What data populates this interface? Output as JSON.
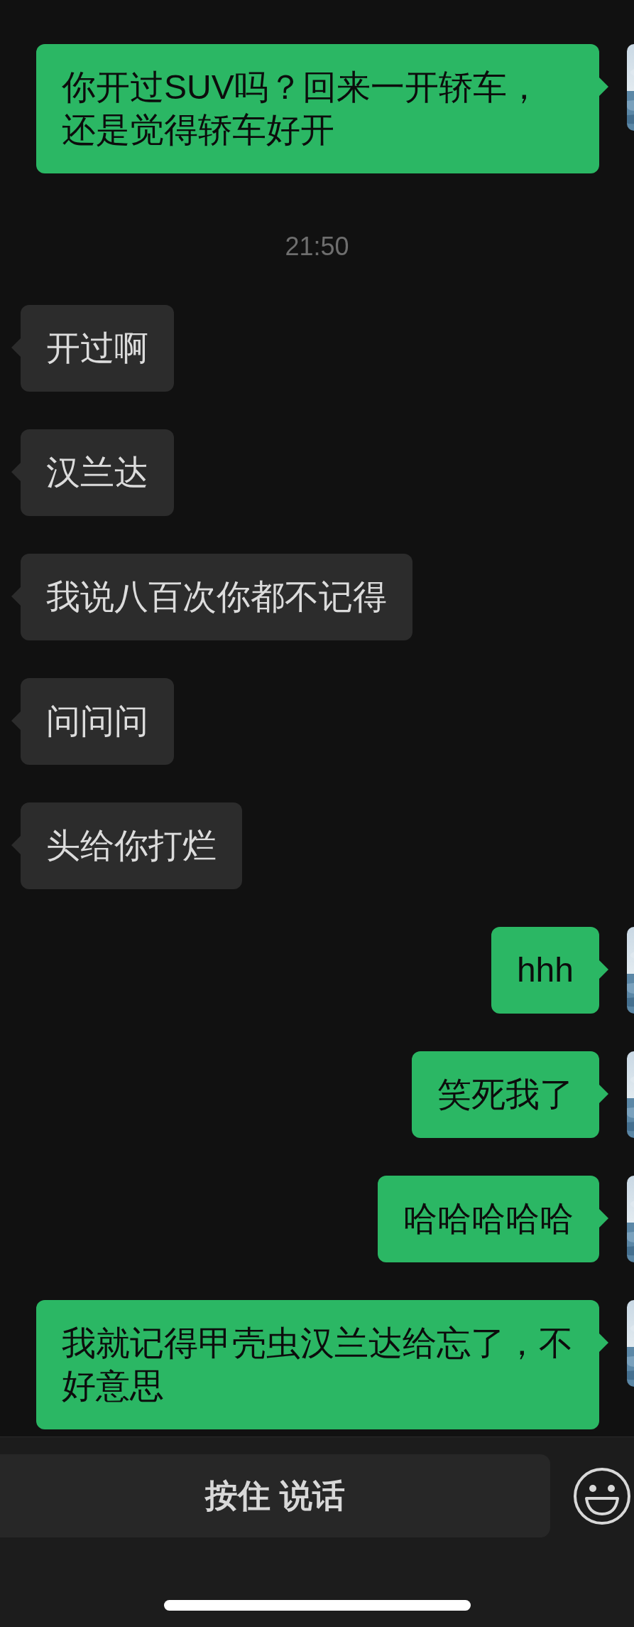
{
  "messages": [
    {
      "kind": "outgoing",
      "text": "你开过SUV吗？回来一开轿车，还是觉得轿车好开"
    },
    {
      "kind": "time",
      "text": "21:50"
    },
    {
      "kind": "incoming",
      "text": "开过啊"
    },
    {
      "kind": "incoming",
      "text": "汉兰达"
    },
    {
      "kind": "incoming",
      "text": "我说八百次你都不记得"
    },
    {
      "kind": "incoming",
      "text": "问问问"
    },
    {
      "kind": "incoming",
      "text": "头给你打烂"
    },
    {
      "kind": "outgoing",
      "text": "hhh"
    },
    {
      "kind": "outgoing",
      "text": "笑死我了"
    },
    {
      "kind": "outgoing",
      "text": "哈哈哈哈哈"
    },
    {
      "kind": "outgoing",
      "text": "我就记得甲壳虫汉兰达给忘了，不好意思"
    }
  ],
  "voice_button": {
    "label": "按住 说话"
  }
}
